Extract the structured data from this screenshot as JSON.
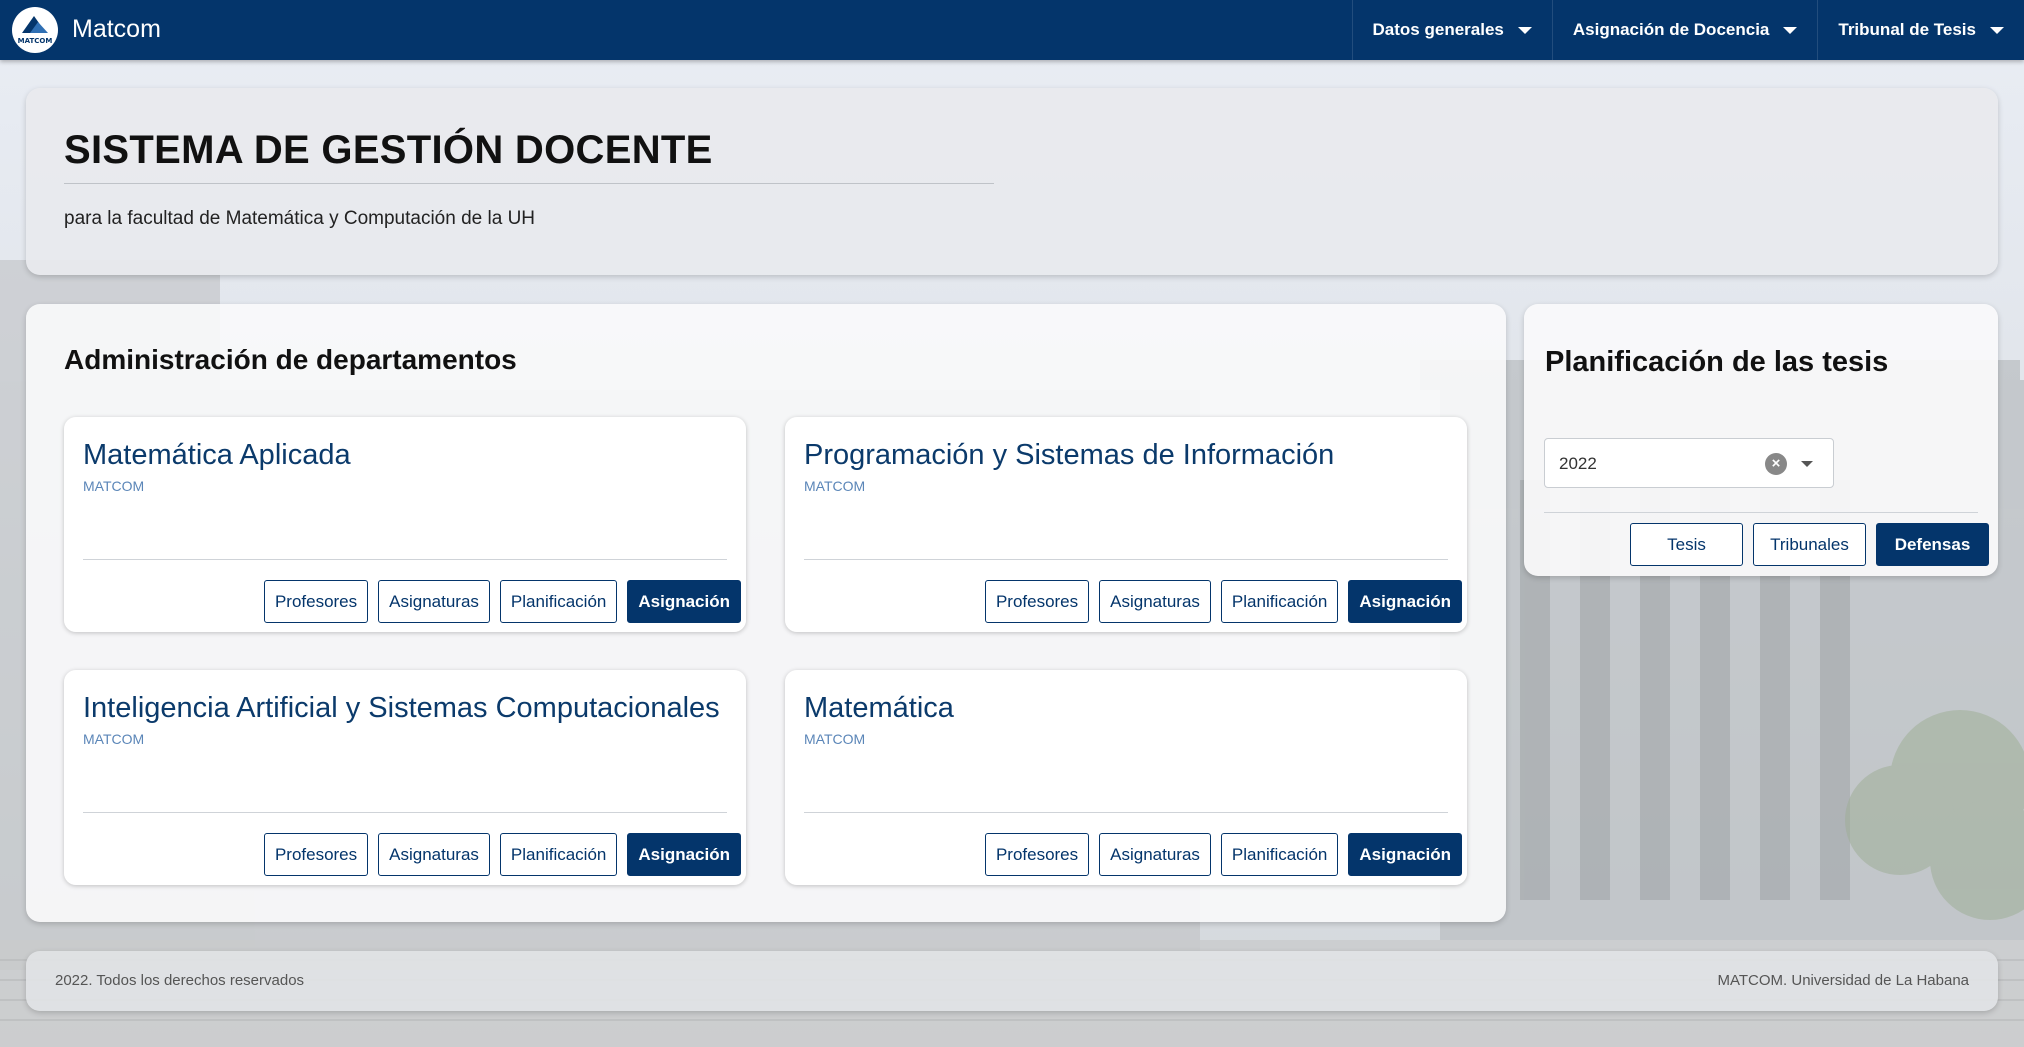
{
  "brand": {
    "logo_text": "MATCOM",
    "name": "Matcom"
  },
  "nav": {
    "items": [
      {
        "label": "Datos generales"
      },
      {
        "label": "Asignación de Docencia"
      },
      {
        "label": "Tribunal de Tesis"
      }
    ]
  },
  "hero": {
    "title": "SISTEMA DE GESTIÓN DOCENTE",
    "subtitle": "para la facultad de Matemática y Computación de la UH"
  },
  "departments": {
    "heading": "Administración de departamentos",
    "cards": [
      {
        "title": "Matemática Aplicada",
        "subtitle": "MATCOM"
      },
      {
        "title": "Programación y Sistemas de Información",
        "subtitle": "MATCOM"
      },
      {
        "title": "Inteligencia Artificial y Sistemas Computacionales",
        "subtitle": "MATCOM"
      },
      {
        "title": "Matemática",
        "subtitle": "MATCOM"
      }
    ],
    "buttons": {
      "profesores": "Profesores",
      "asignaturas": "Asignaturas",
      "planificacion": "Planificación",
      "asignacion": "Asignación"
    }
  },
  "thesis": {
    "heading": "Planificación de las tesis",
    "year_select": {
      "value": "2022"
    },
    "buttons": {
      "tesis": "Tesis",
      "tribunales": "Tribunales",
      "defensas": "Defensas"
    }
  },
  "footer": {
    "left": "2022. Todos los derechos reservados",
    "right": "MATCOM. Universidad de La Habana"
  },
  "colors": {
    "primary": "#04356b",
    "card_title": "#0b3a6b",
    "card_subtitle": "#5b86b8"
  },
  "icons": {
    "logo": "matcom-logo",
    "nav_caret": "caret-down-icon",
    "clear": "clear-icon",
    "dropdown": "dropdown-arrow-icon"
  }
}
